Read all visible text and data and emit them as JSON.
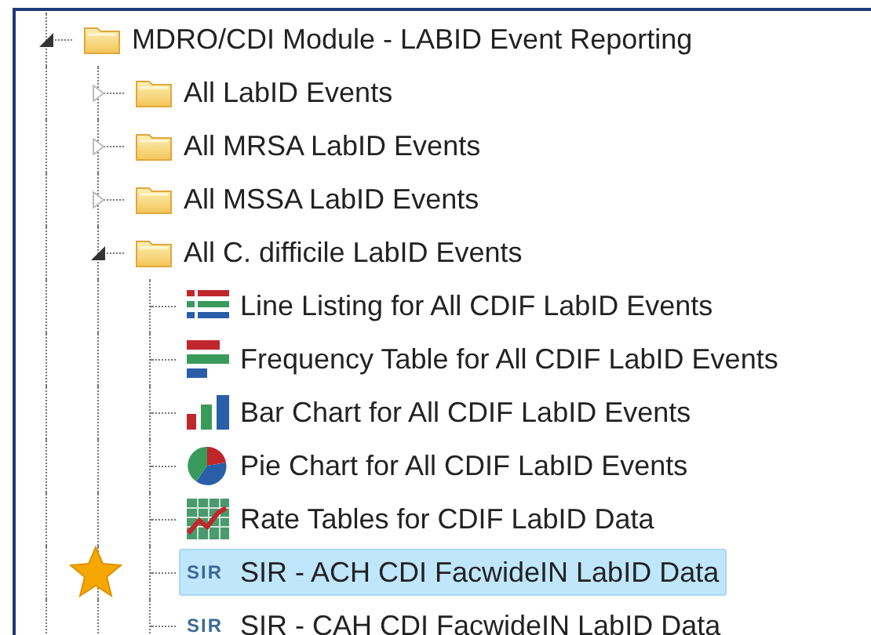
{
  "tree": [
    {
      "kind": "folder",
      "label": "MDRO/CDI Module - LABID Event Reporting",
      "expanded": true,
      "selected": false,
      "children": [
        {
          "kind": "folder",
          "label": "All LabID Events",
          "expanded": false,
          "selected": false
        },
        {
          "kind": "folder",
          "label": "All MRSA LabID Events",
          "expanded": false,
          "selected": false
        },
        {
          "kind": "folder",
          "label": "All MSSA LabID Events",
          "expanded": false,
          "selected": false
        },
        {
          "kind": "folder",
          "label": "All C. difficile LabID Events",
          "expanded": true,
          "selected": false,
          "children": [
            {
              "kind": "line_listing",
              "label": "Line Listing for All CDIF LabID Events",
              "selected": false,
              "favorite": false
            },
            {
              "kind": "frequency_table",
              "label": "Frequency Table for All CDIF LabID Events",
              "selected": false,
              "favorite": false
            },
            {
              "kind": "bar_chart",
              "label": "Bar Chart for All CDIF LabID Events",
              "selected": false,
              "favorite": false
            },
            {
              "kind": "pie_chart",
              "label": "Pie Chart for All CDIF LabID Events",
              "selected": false,
              "favorite": false
            },
            {
              "kind": "rate_table",
              "label": "Rate Tables for CDIF LabID Data",
              "selected": false,
              "favorite": false
            },
            {
              "kind": "sir",
              "badge": "SIR",
              "label": "SIR - ACH CDI FacwideIN LabID Data",
              "selected": true,
              "favorite": true
            },
            {
              "kind": "sir",
              "badge": "SIR",
              "label": "SIR - CAH CDI FacwideIN LabID Data",
              "selected": false,
              "favorite": false
            }
          ]
        }
      ]
    }
  ]
}
